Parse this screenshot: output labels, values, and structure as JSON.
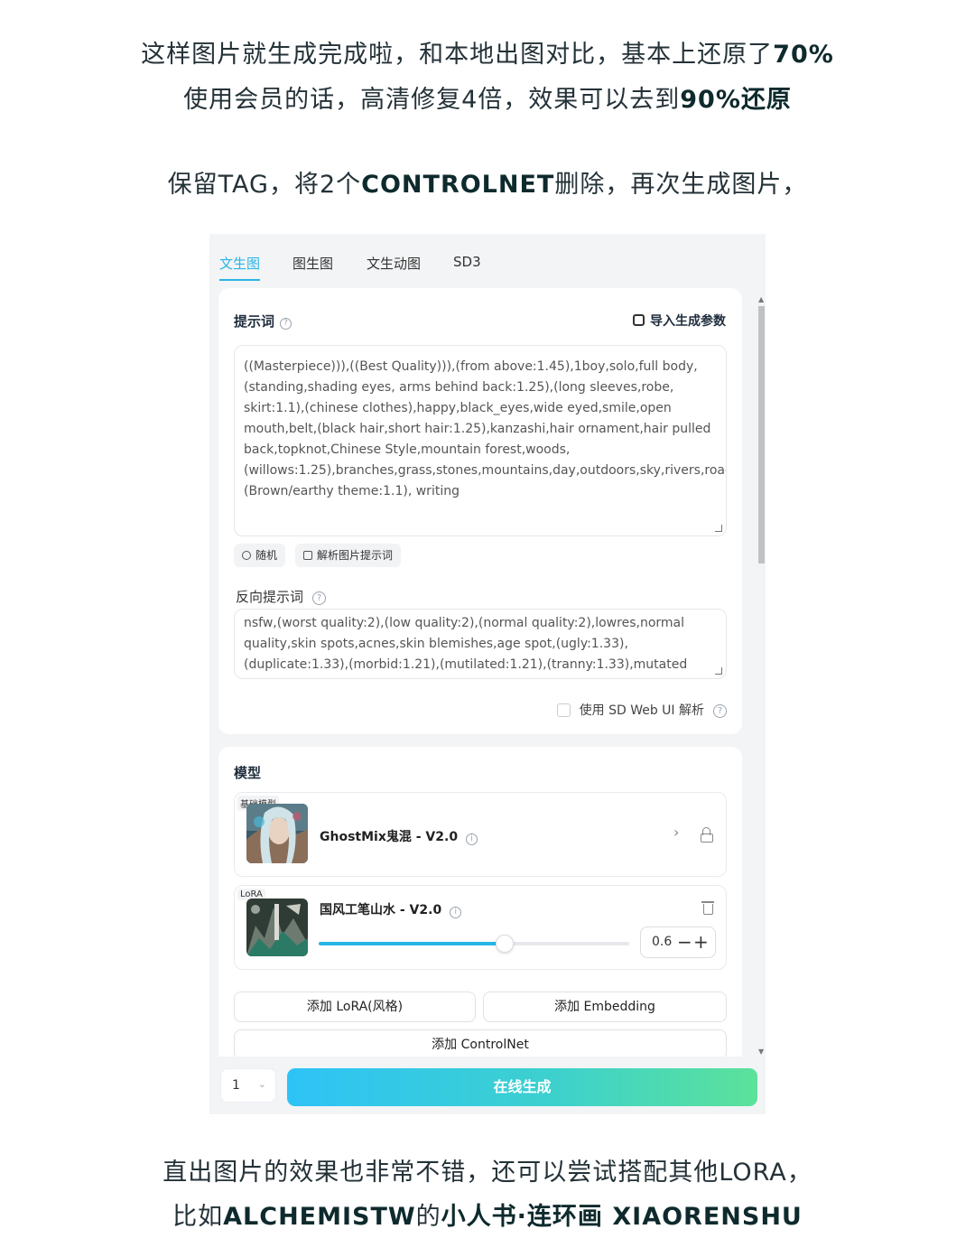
{
  "captions": {
    "line1_a": "这样图片就生成完成啦，和本地出图对比，基本上还原了",
    "line1_b": "70%",
    "line2_a": "使用会员的话，高清修复4倍，效果可以去到",
    "line2_b": "90%还原",
    "line3_a": "保留TAG，将2个",
    "line3_b": "CONTROLNET",
    "line3_c": "删除，再次生成图片，",
    "line4": "直出图片的效果也非常不错，还可以尝试搭配其他LORA，",
    "line5_a": "比如",
    "line5_b": "ALCHEMISTW",
    "line5_c": "的",
    "line5_d": "小人书·连环画 XIAORENSHU"
  },
  "tabs": [
    "文生图",
    "图生图",
    "文生动图",
    "SD3"
  ],
  "prompt": {
    "label": "提示词",
    "import_label": "导入生成参数",
    "text": "((Masterpiece))),((Best Quality))),(from above:1.45),1boy,solo,full body,(standing,shading eyes, arms behind back:1.25),(long sleeves,robe, skirt:1.1),(chinese clothes),happy,black_eyes,wide eyed,smile,open mouth,belt,(black hair,short hair:1.25),kanzashi,hair ornament,hair pulled back,topknot,Chinese Style,mountain forest,woods,(willows:1.25),branches,grass,stones,mountains,day,outdoors,sky,rivers,roads,(Brown/earthy theme:1.1), writing",
    "random_label": "随机",
    "parse_label": "解析图片提示词"
  },
  "negative": {
    "label": "反向提示词",
    "text": "nsfw,(worst quality:2),(low quality:2),(normal quality:2),lowres,normal quality,skin spots,acnes,skin blemishes,age spot,(ugly:1.33),(duplicate:1.33),(morbid:1.21),(mutilated:1.21),(tranny:1.33),mutated hands,(poorly drawn",
    "sdweb_label": "使用 SD Web UI 解析"
  },
  "model": {
    "label": "模型",
    "base_tag": "基础模型",
    "base_name": "GhostMix鬼混 - V2.0",
    "lora_tag": "LoRA",
    "lora_name": "国风工笔山水 - V2.0",
    "lora_weight": "0.6",
    "lora_weight_fraction": 0.6,
    "add_lora": "添加 LoRA(风格)",
    "add_embedding": "添加 Embedding",
    "add_controlnet": "添加 ControlNet"
  },
  "footer": {
    "count": "1",
    "generate_label": "在线生成"
  },
  "colors": {
    "accent": "#27b5e6",
    "gradient_start": "#2ec3f7",
    "gradient_end": "#5ce29a"
  }
}
